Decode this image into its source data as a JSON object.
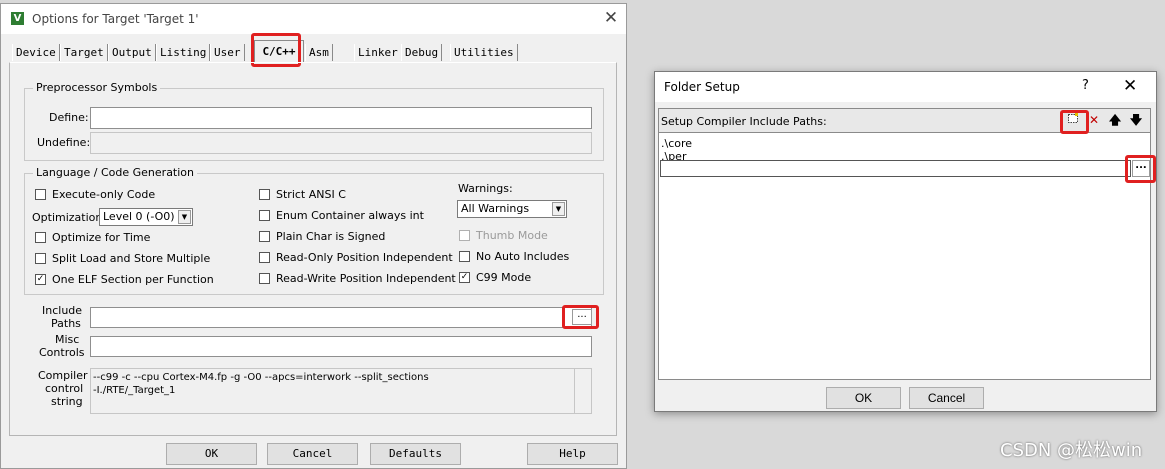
{
  "options_window": {
    "title": "Options for Target 'Target 1'",
    "app_icon_letter": "V",
    "close_glyph": "✕",
    "tabs": [
      {
        "label": "Device"
      },
      {
        "label": "Target"
      },
      {
        "label": "Output"
      },
      {
        "label": "Listing"
      },
      {
        "label": "User"
      },
      {
        "label": "C/C++",
        "active": true
      },
      {
        "label": "Asm"
      },
      {
        "label": "Linker"
      },
      {
        "label": "Debug"
      },
      {
        "label": "Utilities"
      }
    ],
    "preprocessor": {
      "group_title": "Preprocessor Symbols",
      "define_label": "Define:",
      "define_value": "",
      "undefine_label": "Undefine:",
      "undefine_value": ""
    },
    "language": {
      "group_title": "Language / Code Generation",
      "execute_only": {
        "label": "Execute-only Code",
        "checked": false
      },
      "optimization_label": "Optimization:",
      "optimization_value": "Level 0 (-O0)",
      "optimize_time": {
        "label": "Optimize for Time",
        "checked": false
      },
      "split_load": {
        "label": "Split Load and Store Multiple",
        "checked": false
      },
      "one_elf": {
        "label": "One ELF Section per Function",
        "checked": true
      },
      "strict_ansi": {
        "label": "Strict ANSI C",
        "checked": false
      },
      "enum_container": {
        "label": "Enum Container always int",
        "checked": false
      },
      "plain_char": {
        "label": "Plain Char is Signed",
        "checked": false
      },
      "ro_pi": {
        "label": "Read-Only Position Independent",
        "checked": false
      },
      "rw_pi": {
        "label": "Read-Write Position Independent",
        "checked": false
      },
      "warnings_label": "Warnings:",
      "warnings_value": "All Warnings",
      "thumb_mode": {
        "label": "Thumb Mode",
        "checked": false,
        "disabled": true
      },
      "no_auto_includes": {
        "label": "No Auto Includes",
        "checked": false
      },
      "c99_mode": {
        "label": "C99 Mode",
        "checked": true
      }
    },
    "include_paths": {
      "label_line1": "Include",
      "label_line2": "Paths",
      "value": "",
      "browse": "..."
    },
    "misc_controls": {
      "label_line1": "Misc",
      "label_line2": "Controls",
      "value": ""
    },
    "compiler_control": {
      "label_line1": "Compiler",
      "label_line2": "control",
      "label_line3": "string",
      "line1": "--c99 -c --cpu Cortex-M4.fp -g -O0 --apcs=interwork --split_sections",
      "line2": "-I./RTE/_Target_1"
    },
    "buttons": {
      "ok": "OK",
      "cancel": "Cancel",
      "defaults": "Defaults",
      "help": "Help"
    }
  },
  "folder_setup": {
    "title": "Folder Setup",
    "help_glyph": "?",
    "close_glyph": "✕",
    "header_label": "Setup Compiler Include Paths:",
    "paths": [
      ".\\core",
      ".\\per"
    ],
    "edit_value": "",
    "browse": "...",
    "toolbar": {
      "new_icon": "new-folder-icon",
      "delete_icon": "delete-icon",
      "move_up_icon": "arrow-up-icon",
      "move_down_icon": "arrow-down-icon"
    },
    "buttons": {
      "ok": "OK",
      "cancel": "Cancel"
    }
  },
  "watermark": "CSDN @松松win",
  "colors": {
    "highlight_box": "#e02020",
    "window_bg": "#f0f0f0"
  }
}
